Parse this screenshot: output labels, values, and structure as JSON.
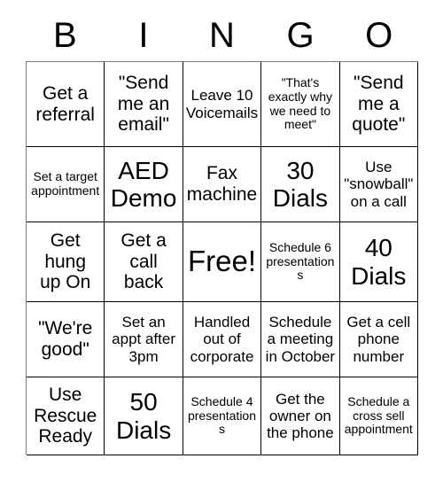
{
  "card": {
    "title_letters": [
      "B",
      "I",
      "N",
      "G",
      "O"
    ],
    "free_space_label": "Free!",
    "columns": 5,
    "rows": 5,
    "colors": {
      "background": "#ffffff",
      "text": "#000000",
      "border": "#000000"
    },
    "cells": [
      {
        "id": "b1",
        "text": "Get a\nreferral",
        "size": "md"
      },
      {
        "id": "i1",
        "text": "\"Send\nme an\nemail\"",
        "size": "md"
      },
      {
        "id": "n1",
        "text": "Leave 10\nVoicemails",
        "size": "sm"
      },
      {
        "id": "g1",
        "text": "\"That's\nexactly why\nwe need to\nmeet\"",
        "size": "xs"
      },
      {
        "id": "o1",
        "text": "\"Send\nme a\nquote\"",
        "size": "md"
      },
      {
        "id": "b2",
        "text": "Set a target\nappointment",
        "size": "xs"
      },
      {
        "id": "i2",
        "text": "AED\nDemo",
        "size": "lg"
      },
      {
        "id": "n2",
        "text": "Fax\nmachine",
        "size": "md"
      },
      {
        "id": "g2",
        "text": "30\nDials",
        "size": "lg"
      },
      {
        "id": "o2",
        "text": "Use\n\"snowball\"\non a call",
        "size": "sm"
      },
      {
        "id": "b3",
        "text": "Get\nhung\nup On",
        "size": "md"
      },
      {
        "id": "i3",
        "text": "Get a\ncall\nback",
        "size": "md"
      },
      {
        "id": "n3",
        "text": "Free!",
        "size": "xl"
      },
      {
        "id": "g3",
        "text": "Schedule 6\npresentations",
        "size": "xs"
      },
      {
        "id": "o3",
        "text": "40\nDials",
        "size": "lg"
      },
      {
        "id": "b4",
        "text": "\"We're\ngood\"",
        "size": "md"
      },
      {
        "id": "i4",
        "text": "Set an\nappt after\n3pm",
        "size": "sm"
      },
      {
        "id": "n4",
        "text": "Handled\nout of\ncorporate",
        "size": "sm"
      },
      {
        "id": "g4",
        "text": "Schedule\na meeting\nin October",
        "size": "sm"
      },
      {
        "id": "o4",
        "text": "Get a cell\nphone\nnumber",
        "size": "sm"
      },
      {
        "id": "b5",
        "text": "Use\nRescue\nReady",
        "size": "md"
      },
      {
        "id": "i5",
        "text": "50\nDials",
        "size": "lg"
      },
      {
        "id": "n5",
        "text": "Schedule 4\npresentations",
        "size": "xs"
      },
      {
        "id": "g5",
        "text": "Get the\nowner on\nthe phone",
        "size": "sm"
      },
      {
        "id": "o5",
        "text": "Schedule a\ncross sell\nappointment",
        "size": "xs"
      }
    ]
  }
}
